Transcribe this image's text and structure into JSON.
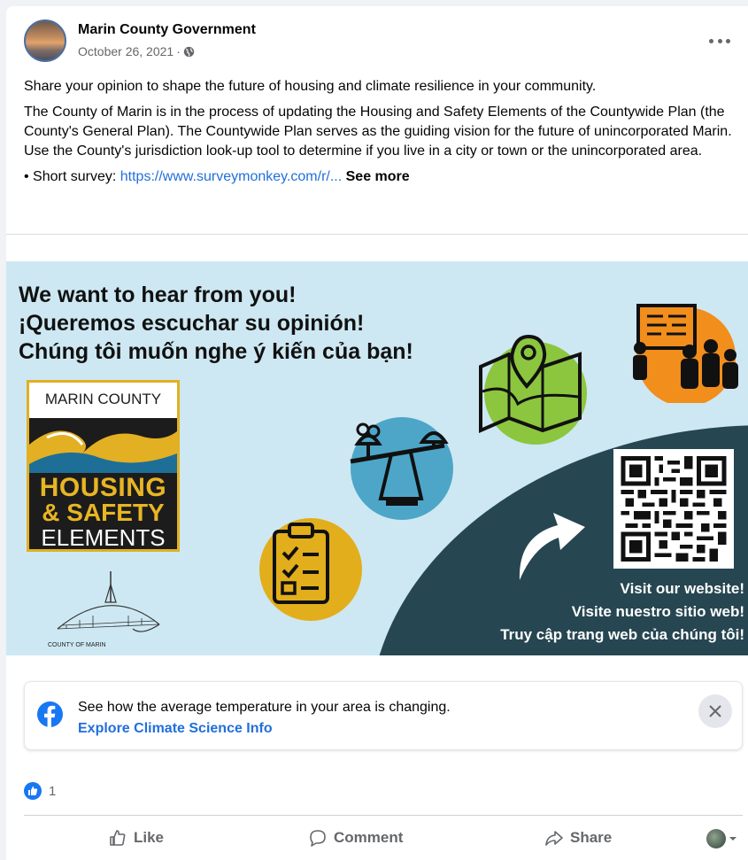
{
  "post": {
    "author": "Marin County Government",
    "date": "October 26, 2021",
    "separator": " · ",
    "paragraph1": "Share your opinion to shape the future of housing and climate resilience in your community.",
    "paragraph2": "The County of Marin is in the process of updating the Housing and Safety Elements of the Countywide Plan (the County's General Plan). The Countywide Plan serves as the guiding vision for the future of unincorporated Marin. Use the County's jurisdiction look-up tool to determine if you live in a city or town or the unincorporated area.",
    "survey_prefix": "• Short survey: ",
    "survey_link": "https://www.surveymonkey.com/r/...",
    "see_more": " See more"
  },
  "image": {
    "headline_en": "We want to hear from you!",
    "headline_es": "¡Queremos escuchar su opinión!",
    "headline_vi": "Chúng tôi muốn nghe ý kiến của bạn!",
    "logo_top": "MARIN COUNTY",
    "logo_line1": "HOUSING",
    "logo_line2": "& SAFETY",
    "logo_line3": "ELEMENTS",
    "seal_text": "COUNTY OF MARIN",
    "visit_en": "Visit our website!",
    "visit_es": "Visite nuestro sitio web!",
    "visit_vi": "Truy cập trang web của chúng tôi!"
  },
  "notice": {
    "text": "See how the average temperature in your area is changing.",
    "link": "Explore Climate Science Info"
  },
  "reactions": {
    "count": "1"
  },
  "actions": {
    "like": "Like",
    "comment": "Comment",
    "share": "Share"
  },
  "colors": {
    "link_blue": "#216fdb",
    "fb_blue": "#1877f2",
    "image_bg": "#cde8f2",
    "dark_teal": "#264651",
    "logo_gold": "#e8b524"
  }
}
